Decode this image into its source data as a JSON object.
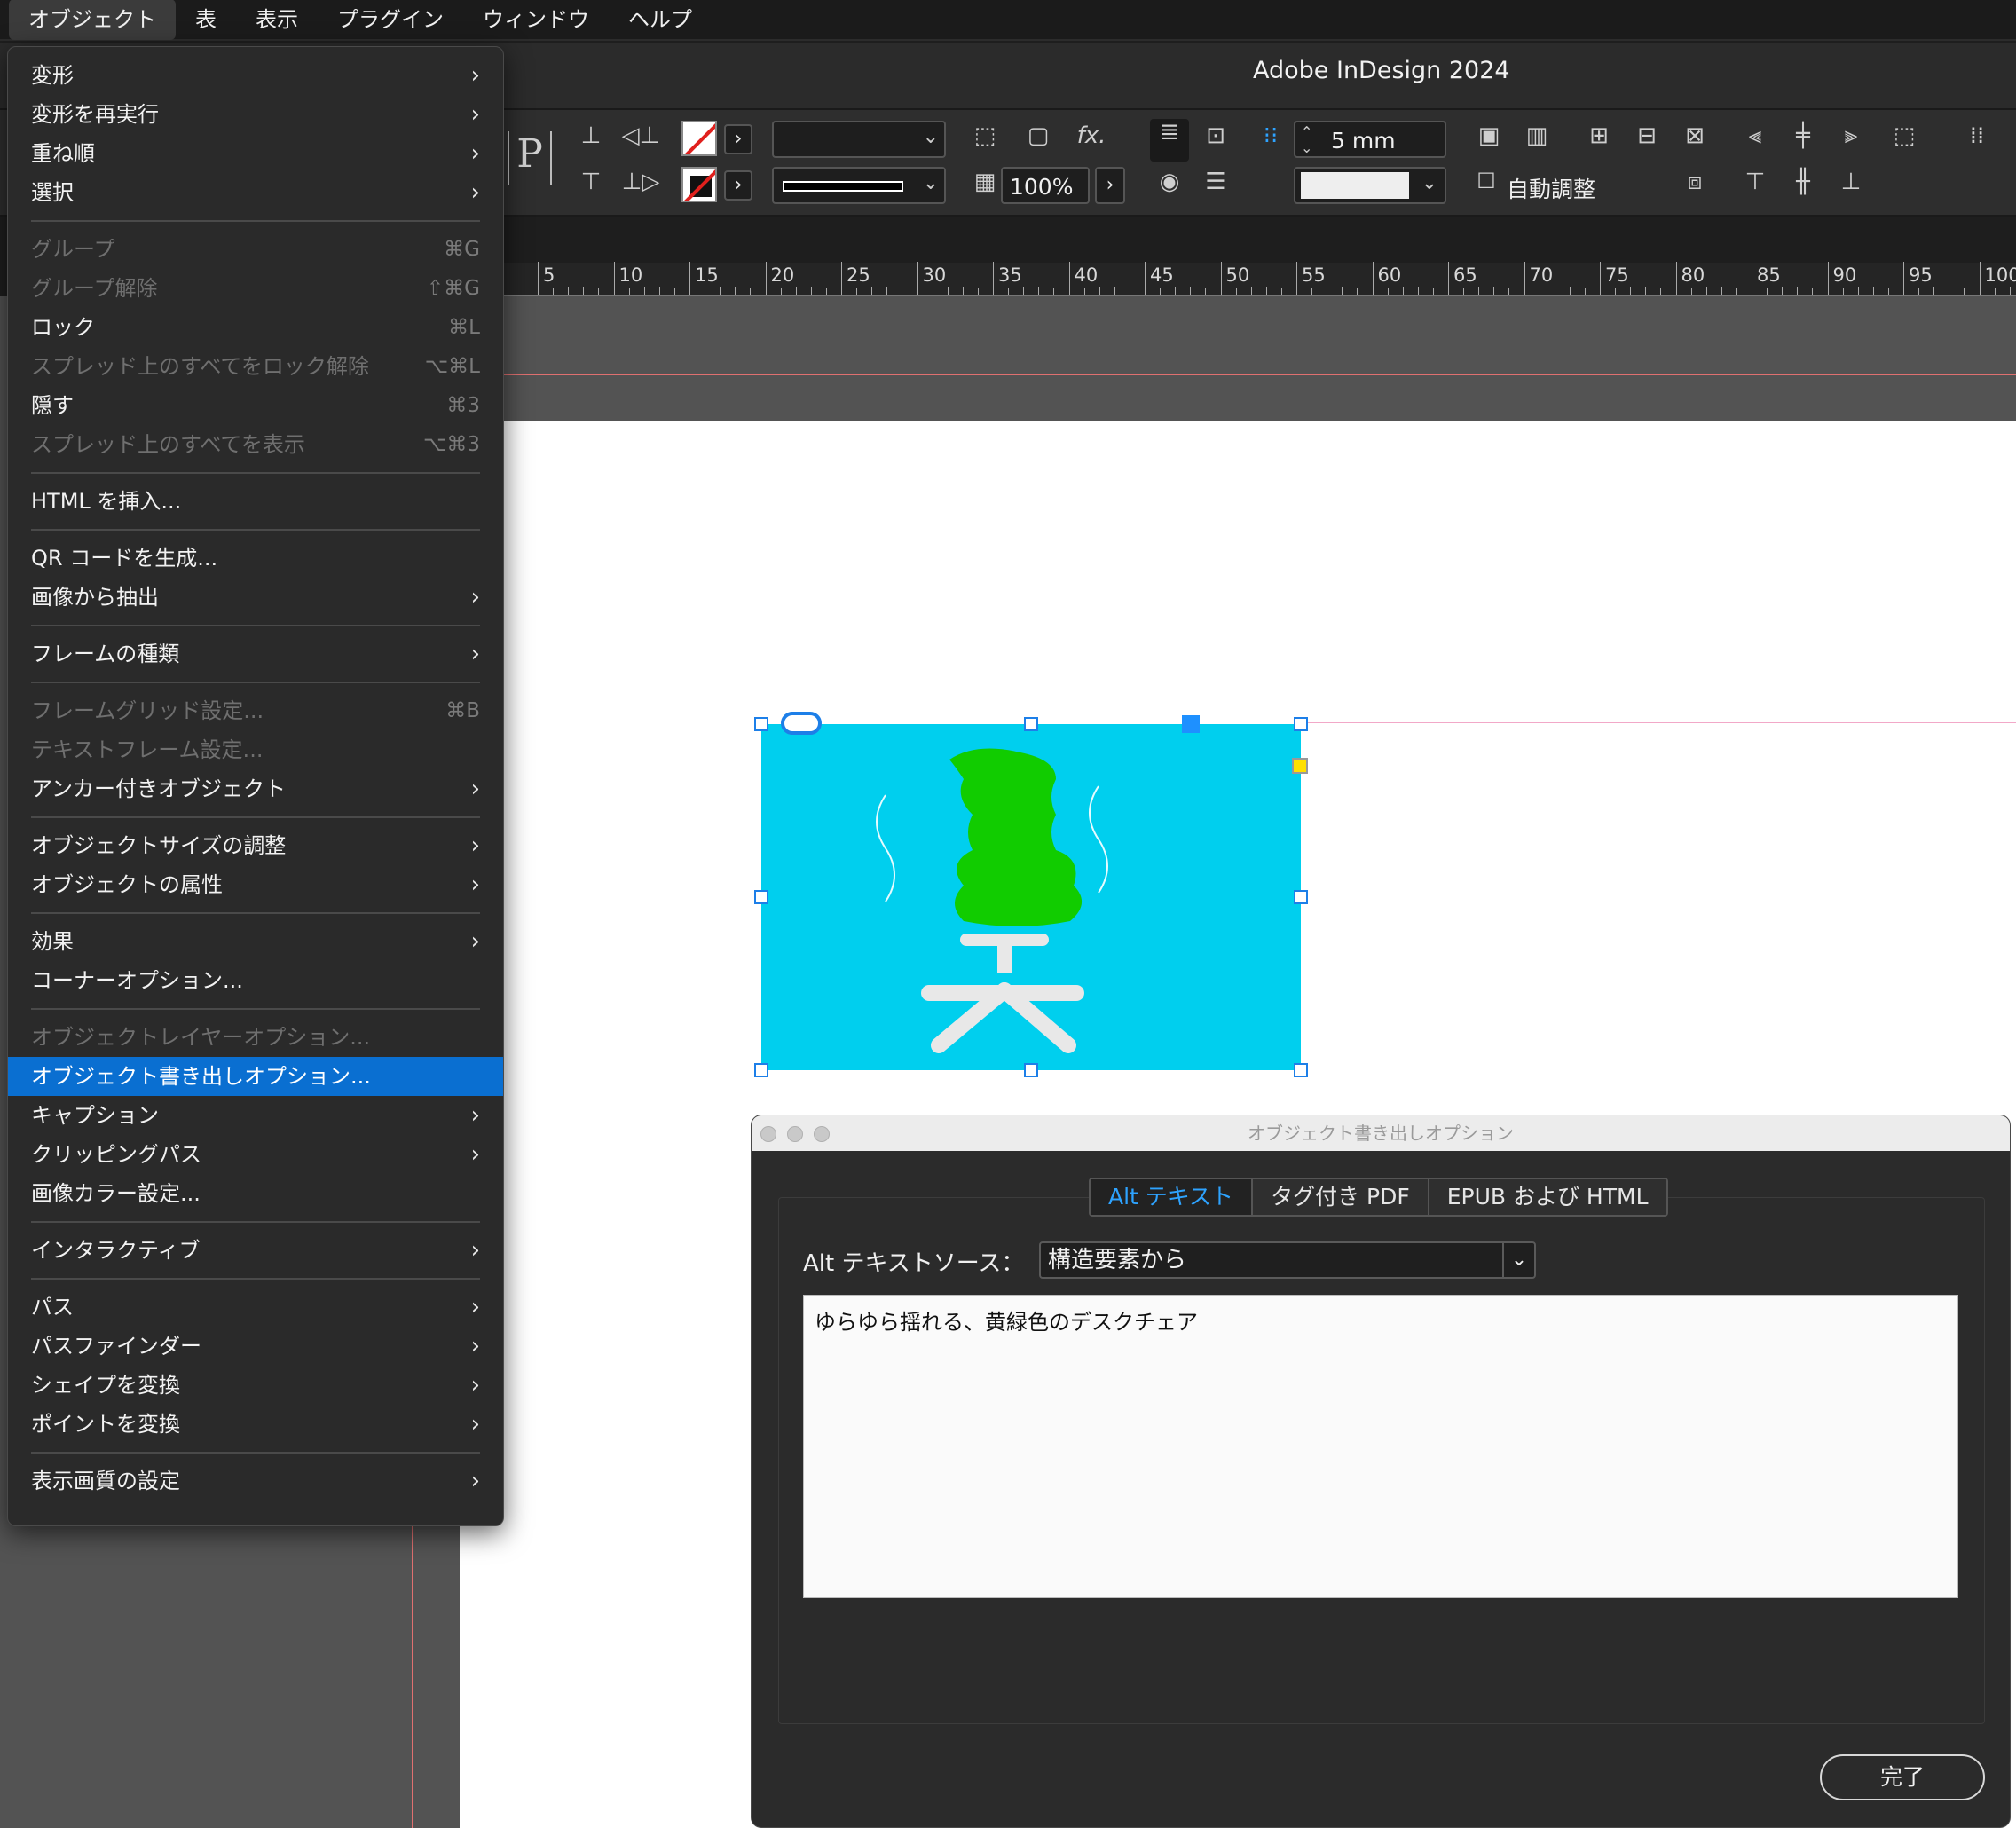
{
  "menubar": {
    "items": [
      "オブジェクト",
      "表",
      "表示",
      "プラグイン",
      "ウィンドウ",
      "ヘルプ"
    ]
  },
  "app": {
    "title": "Adobe InDesign 2024"
  },
  "controlbar": {
    "p_glyph": "P",
    "opacity": "100%",
    "spacing": "5 mm",
    "autofit_label": "自動調整",
    "fx_label": "fx."
  },
  "ruler": {
    "labels": [
      "5",
      "10",
      "15",
      "20",
      "25",
      "30",
      "35",
      "40",
      "45",
      "50",
      "55",
      "60",
      "65",
      "70",
      "75",
      "80",
      "85",
      "90",
      "95",
      "100"
    ]
  },
  "object_menu": {
    "items": [
      {
        "label": "変形",
        "sub": true
      },
      {
        "label": "変形を再実行",
        "sub": true
      },
      {
        "label": "重ね順",
        "sub": true
      },
      {
        "label": "選択",
        "sub": true
      },
      {
        "sep": true
      },
      {
        "label": "グループ",
        "shortcut": "⌘G",
        "disabled": true
      },
      {
        "label": "グループ解除",
        "shortcut": "⇧⌘G",
        "disabled": true
      },
      {
        "label": "ロック",
        "shortcut": "⌘L"
      },
      {
        "label": "スプレッド上のすべてをロック解除",
        "shortcut": "⌥⌘L",
        "disabled": true
      },
      {
        "label": "隠す",
        "shortcut": "⌘3"
      },
      {
        "label": "スプレッド上のすべてを表示",
        "shortcut": "⌥⌘3",
        "disabled": true
      },
      {
        "sep": true
      },
      {
        "label": "HTML を挿入..."
      },
      {
        "sep": true
      },
      {
        "label": "QR コードを生成..."
      },
      {
        "label": "画像から抽出",
        "sub": true
      },
      {
        "sep": true
      },
      {
        "label": "フレームの種類",
        "sub": true
      },
      {
        "sep": true
      },
      {
        "label": "フレームグリッド設定...",
        "shortcut": "⌘B",
        "disabled": true
      },
      {
        "label": "テキストフレーム設定...",
        "disabled": true
      },
      {
        "label": "アンカー付きオブジェクト",
        "sub": true
      },
      {
        "sep": true
      },
      {
        "label": "オブジェクトサイズの調整",
        "sub": true
      },
      {
        "label": "オブジェクトの属性",
        "sub": true
      },
      {
        "sep": true
      },
      {
        "label": "効果",
        "sub": true
      },
      {
        "label": "コーナーオプション..."
      },
      {
        "sep": true
      },
      {
        "label": "オブジェクトレイヤーオプション...",
        "disabled": true
      },
      {
        "label": "オブジェクト書き出しオプション...",
        "selected": true
      },
      {
        "label": "キャプション",
        "sub": true
      },
      {
        "label": "クリッピングパス",
        "sub": true
      },
      {
        "label": "画像カラー設定..."
      },
      {
        "sep": true
      },
      {
        "label": "インタラクティブ",
        "sub": true
      },
      {
        "sep": true
      },
      {
        "label": "パス",
        "sub": true
      },
      {
        "label": "パスファインダー",
        "sub": true
      },
      {
        "label": "シェイプを変換",
        "sub": true
      },
      {
        "label": "ポイントを変換",
        "sub": true
      },
      {
        "sep": true
      },
      {
        "label": "表示画質の設定",
        "sub": true
      }
    ]
  },
  "dialog": {
    "title": "オブジェクト書き出しオプション",
    "tabs": [
      "Alt テキスト",
      "タグ付き PDF",
      "EPUB および HTML"
    ],
    "active_tab": 0,
    "source_label": "Alt テキストソース：",
    "source_value": "構造要素から",
    "alt_text": "ゆらゆら揺れる、黄緑色のデスクチェア",
    "done_label": "完了"
  },
  "colors": {
    "accent": "#0a6fd1",
    "image_bg": "#00cfee",
    "chair_green": "#11cc00",
    "tab_active": "#2ea3ff"
  }
}
